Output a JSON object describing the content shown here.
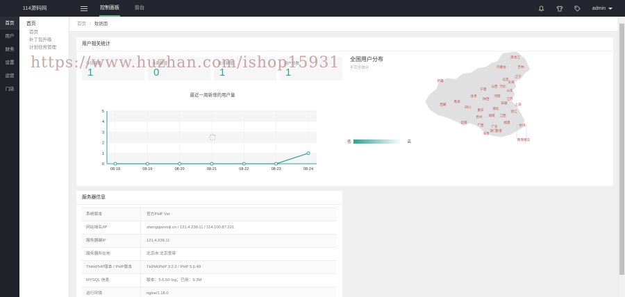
{
  "app": {
    "logo": "114源码网"
  },
  "topnav": [
    {
      "label": "控制面板",
      "active": true
    },
    {
      "label": "前台",
      "active": false
    }
  ],
  "user": {
    "name": "admin"
  },
  "mainmenu": [
    "首页",
    "用户",
    "财务",
    "设置",
    "运营",
    "门店"
  ],
  "submenu": {
    "group": "首页",
    "items": [
      "首页",
      "补丁包升级",
      "计划任务管理"
    ]
  },
  "breadcrumb": {
    "home": "首页",
    "sep": "/",
    "current": "数据面"
  },
  "user_stats": {
    "title": "用户相关统计",
    "cards": [
      {
        "label": "今日新增",
        "value": "1"
      },
      {
        "label": "本周新增",
        "value": "0"
      },
      {
        "label": "本月新增",
        "value": "1"
      },
      {
        "label": "用户总数",
        "value": "1"
      }
    ]
  },
  "watermark": "https://www.huzhan.com/ishop15931",
  "chart_data": {
    "type": "line",
    "title": "最近一周新增的用户量",
    "categories": [
      "08-18",
      "08-19",
      "08-20",
      "08-21",
      "08-22",
      "08-23",
      "08-24"
    ],
    "series": [
      {
        "values": [
          0,
          0,
          0,
          0,
          0,
          0,
          1
        ]
      }
    ],
    "ylim": [
      0,
      5
    ],
    "yticks": [
      "0",
      "1",
      "2",
      "3",
      "4",
      "5"
    ],
    "color": "#26a69a",
    "grid": true
  },
  "map": {
    "title": "全国用户分布",
    "subtitle": "不完全统计",
    "legend_low": "低",
    "legend_high": "高",
    "provinces": [
      "黑龙江",
      "吉林",
      "辽宁",
      "内蒙古",
      "北京",
      "天津",
      "河北",
      "山西",
      "山东",
      "宁夏",
      "甘肃",
      "陕西",
      "河南",
      "江苏",
      "安徽",
      "上海",
      "湖北",
      "四川",
      "重庆",
      "浙江",
      "江西",
      "湖南",
      "贵州",
      "福建",
      "云南",
      "广西",
      "广东",
      "台湾",
      "海南",
      "新疆",
      "西藏",
      "青海",
      "澳门",
      "香港",
      "南海诸岛"
    ]
  },
  "server_info": {
    "title": "服务器信息",
    "rows": [
      {
        "key": "系统版本",
        "value": "官方PHP Ver"
      },
      {
        "key": "网站域名/IP",
        "value": "shengqianmiji.cn / 121.4.238.11 / 114.100.87.221"
      },
      {
        "key": "服务器端IP",
        "value": "121.4.238.11"
      },
      {
        "key": "服务器所在地",
        "value": "北京市 北京宽带"
      },
      {
        "key": "ThinkPHP版本 / PHP版本",
        "value": "THINKPHP 3.2.2 / PHP 5.6.40"
      },
      {
        "key": "MYSQL 信息",
        "value": "版本：5.6.50-log；已用：9.3M"
      },
      {
        "key": "运行环境",
        "value": "nginx/1.18.0"
      }
    ]
  }
}
